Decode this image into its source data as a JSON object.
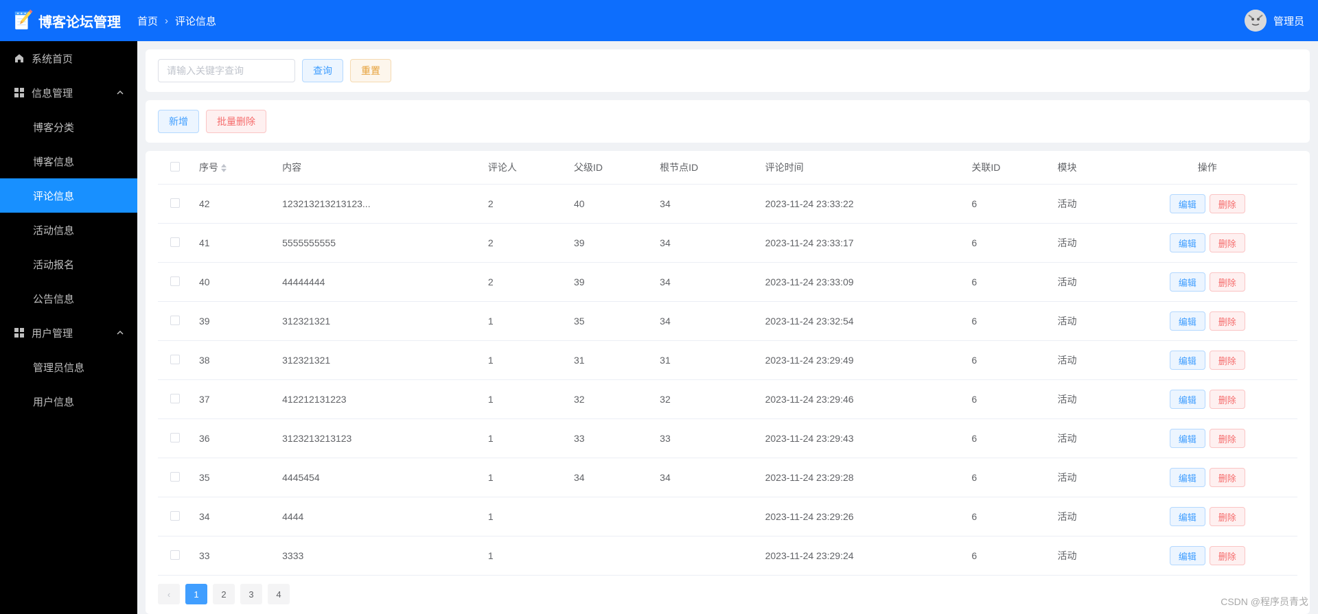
{
  "header": {
    "app_name": "博客论坛管理",
    "breadcrumb": {
      "home": "首页",
      "current": "评论信息"
    },
    "username": "管理员"
  },
  "sidebar": {
    "items": [
      {
        "label": "系统首页",
        "icon": "home",
        "type": "link"
      },
      {
        "label": "信息管理",
        "icon": "grid",
        "type": "group",
        "expanded": true,
        "children": [
          {
            "label": "博客分类"
          },
          {
            "label": "博客信息"
          },
          {
            "label": "评论信息",
            "active": true
          },
          {
            "label": "活动信息"
          },
          {
            "label": "活动报名"
          },
          {
            "label": "公告信息"
          }
        ]
      },
      {
        "label": "用户管理",
        "icon": "grid",
        "type": "group",
        "expanded": true,
        "children": [
          {
            "label": "管理员信息"
          },
          {
            "label": "用户信息"
          }
        ]
      }
    ]
  },
  "search": {
    "placeholder": "请输入关键字查询",
    "query_btn": "查询",
    "reset_btn": "重置"
  },
  "actions": {
    "add_btn": "新增",
    "batch_delete_btn": "批量删除"
  },
  "table": {
    "headers": {
      "seq": "序号",
      "content": "内容",
      "commenter": "评论人",
      "parent_id": "父级ID",
      "root_id": "根节点ID",
      "time": "评论时间",
      "relation_id": "关联ID",
      "module": "模块",
      "ops": "操作"
    },
    "op_labels": {
      "edit": "编辑",
      "delete": "删除"
    },
    "rows": [
      {
        "seq": "42",
        "content": "123213213213123...",
        "commenter": "2",
        "parent_id": "40",
        "root_id": "34",
        "time": "2023-11-24 23:33:22",
        "relation_id": "6",
        "module": "活动"
      },
      {
        "seq": "41",
        "content": "5555555555",
        "commenter": "2",
        "parent_id": "39",
        "root_id": "34",
        "time": "2023-11-24 23:33:17",
        "relation_id": "6",
        "module": "活动"
      },
      {
        "seq": "40",
        "content": "44444444",
        "commenter": "2",
        "parent_id": "39",
        "root_id": "34",
        "time": "2023-11-24 23:33:09",
        "relation_id": "6",
        "module": "活动"
      },
      {
        "seq": "39",
        "content": "312321321",
        "commenter": "1",
        "parent_id": "35",
        "root_id": "34",
        "time": "2023-11-24 23:32:54",
        "relation_id": "6",
        "module": "活动"
      },
      {
        "seq": "38",
        "content": "312321321",
        "commenter": "1",
        "parent_id": "31",
        "root_id": "31",
        "time": "2023-11-24 23:29:49",
        "relation_id": "6",
        "module": "活动"
      },
      {
        "seq": "37",
        "content": "412212131223",
        "commenter": "1",
        "parent_id": "32",
        "root_id": "32",
        "time": "2023-11-24 23:29:46",
        "relation_id": "6",
        "module": "活动"
      },
      {
        "seq": "36",
        "content": "3123213213123",
        "commenter": "1",
        "parent_id": "33",
        "root_id": "33",
        "time": "2023-11-24 23:29:43",
        "relation_id": "6",
        "module": "活动"
      },
      {
        "seq": "35",
        "content": "4445454",
        "commenter": "1",
        "parent_id": "34",
        "root_id": "34",
        "time": "2023-11-24 23:29:28",
        "relation_id": "6",
        "module": "活动"
      },
      {
        "seq": "34",
        "content": "4444",
        "commenter": "1",
        "parent_id": "",
        "root_id": "",
        "time": "2023-11-24 23:29:26",
        "relation_id": "6",
        "module": "活动"
      },
      {
        "seq": "33",
        "content": "3333",
        "commenter": "1",
        "parent_id": "",
        "root_id": "",
        "time": "2023-11-24 23:29:24",
        "relation_id": "6",
        "module": "活动"
      }
    ]
  },
  "pagination": {
    "prev": "<",
    "pages": [
      "1",
      "2",
      "3",
      "4"
    ],
    "active": "1"
  },
  "watermark": "CSDN @程序员青戈"
}
